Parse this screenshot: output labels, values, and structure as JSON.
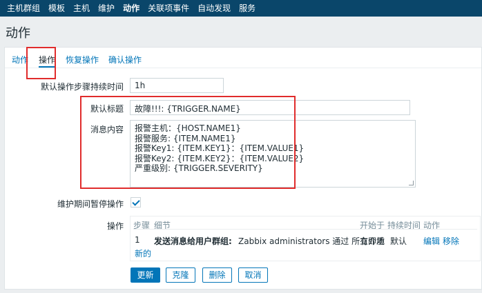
{
  "topnav": {
    "items": [
      "主机群组",
      "模板",
      "主机",
      "维护",
      "动作",
      "关联项事件",
      "自动发现",
      "服务"
    ],
    "active": "动作"
  },
  "page": {
    "title": "动作"
  },
  "tabs": [
    "动作",
    "操作",
    "恢复操作",
    "确认操作"
  ],
  "form": {
    "step_duration": {
      "label": "默认操作步骤持续时间",
      "value": "1h"
    },
    "default_subject": {
      "label": "默认标题",
      "value": "故障!!!: {TRIGGER.NAME}"
    },
    "message": {
      "label": "消息内容",
      "lines": [
        "报警主机：{HOST.NAME1}",
        "报警服务: {ITEM.NAME1}",
        "报警Key1: {ITEM.KEY1}：{ITEM.VALUE1}",
        "报警Key2: {ITEM.KEY2}：{ITEM.VALUE2}",
        "严重级别: {TRIGGER.SEVERITY}"
      ]
    },
    "pause_in_maintenance": {
      "label": "维护期间暂停操作",
      "checked": true
    },
    "operations": {
      "label": "操作",
      "headers": {
        "steps": "步骤",
        "details": "细节",
        "start_in": "开始于",
        "duration": "持续时间",
        "action": "动作"
      },
      "rows": [
        {
          "step": "1",
          "detail_bold": "发送消息给用户群组:",
          "detail_rest": "Zabbix administrators 通过 所有介质",
          "start_in": "立即地",
          "duration": "默认",
          "edit": "编辑",
          "remove": "移除"
        }
      ],
      "new_link": "新的"
    }
  },
  "buttons": {
    "update": "更新",
    "clone": "克隆",
    "delete": "删除",
    "cancel": "取消"
  },
  "colors": {
    "header": "#0a466a",
    "accent": "#0275b8",
    "highlight": "#e02b2b"
  }
}
